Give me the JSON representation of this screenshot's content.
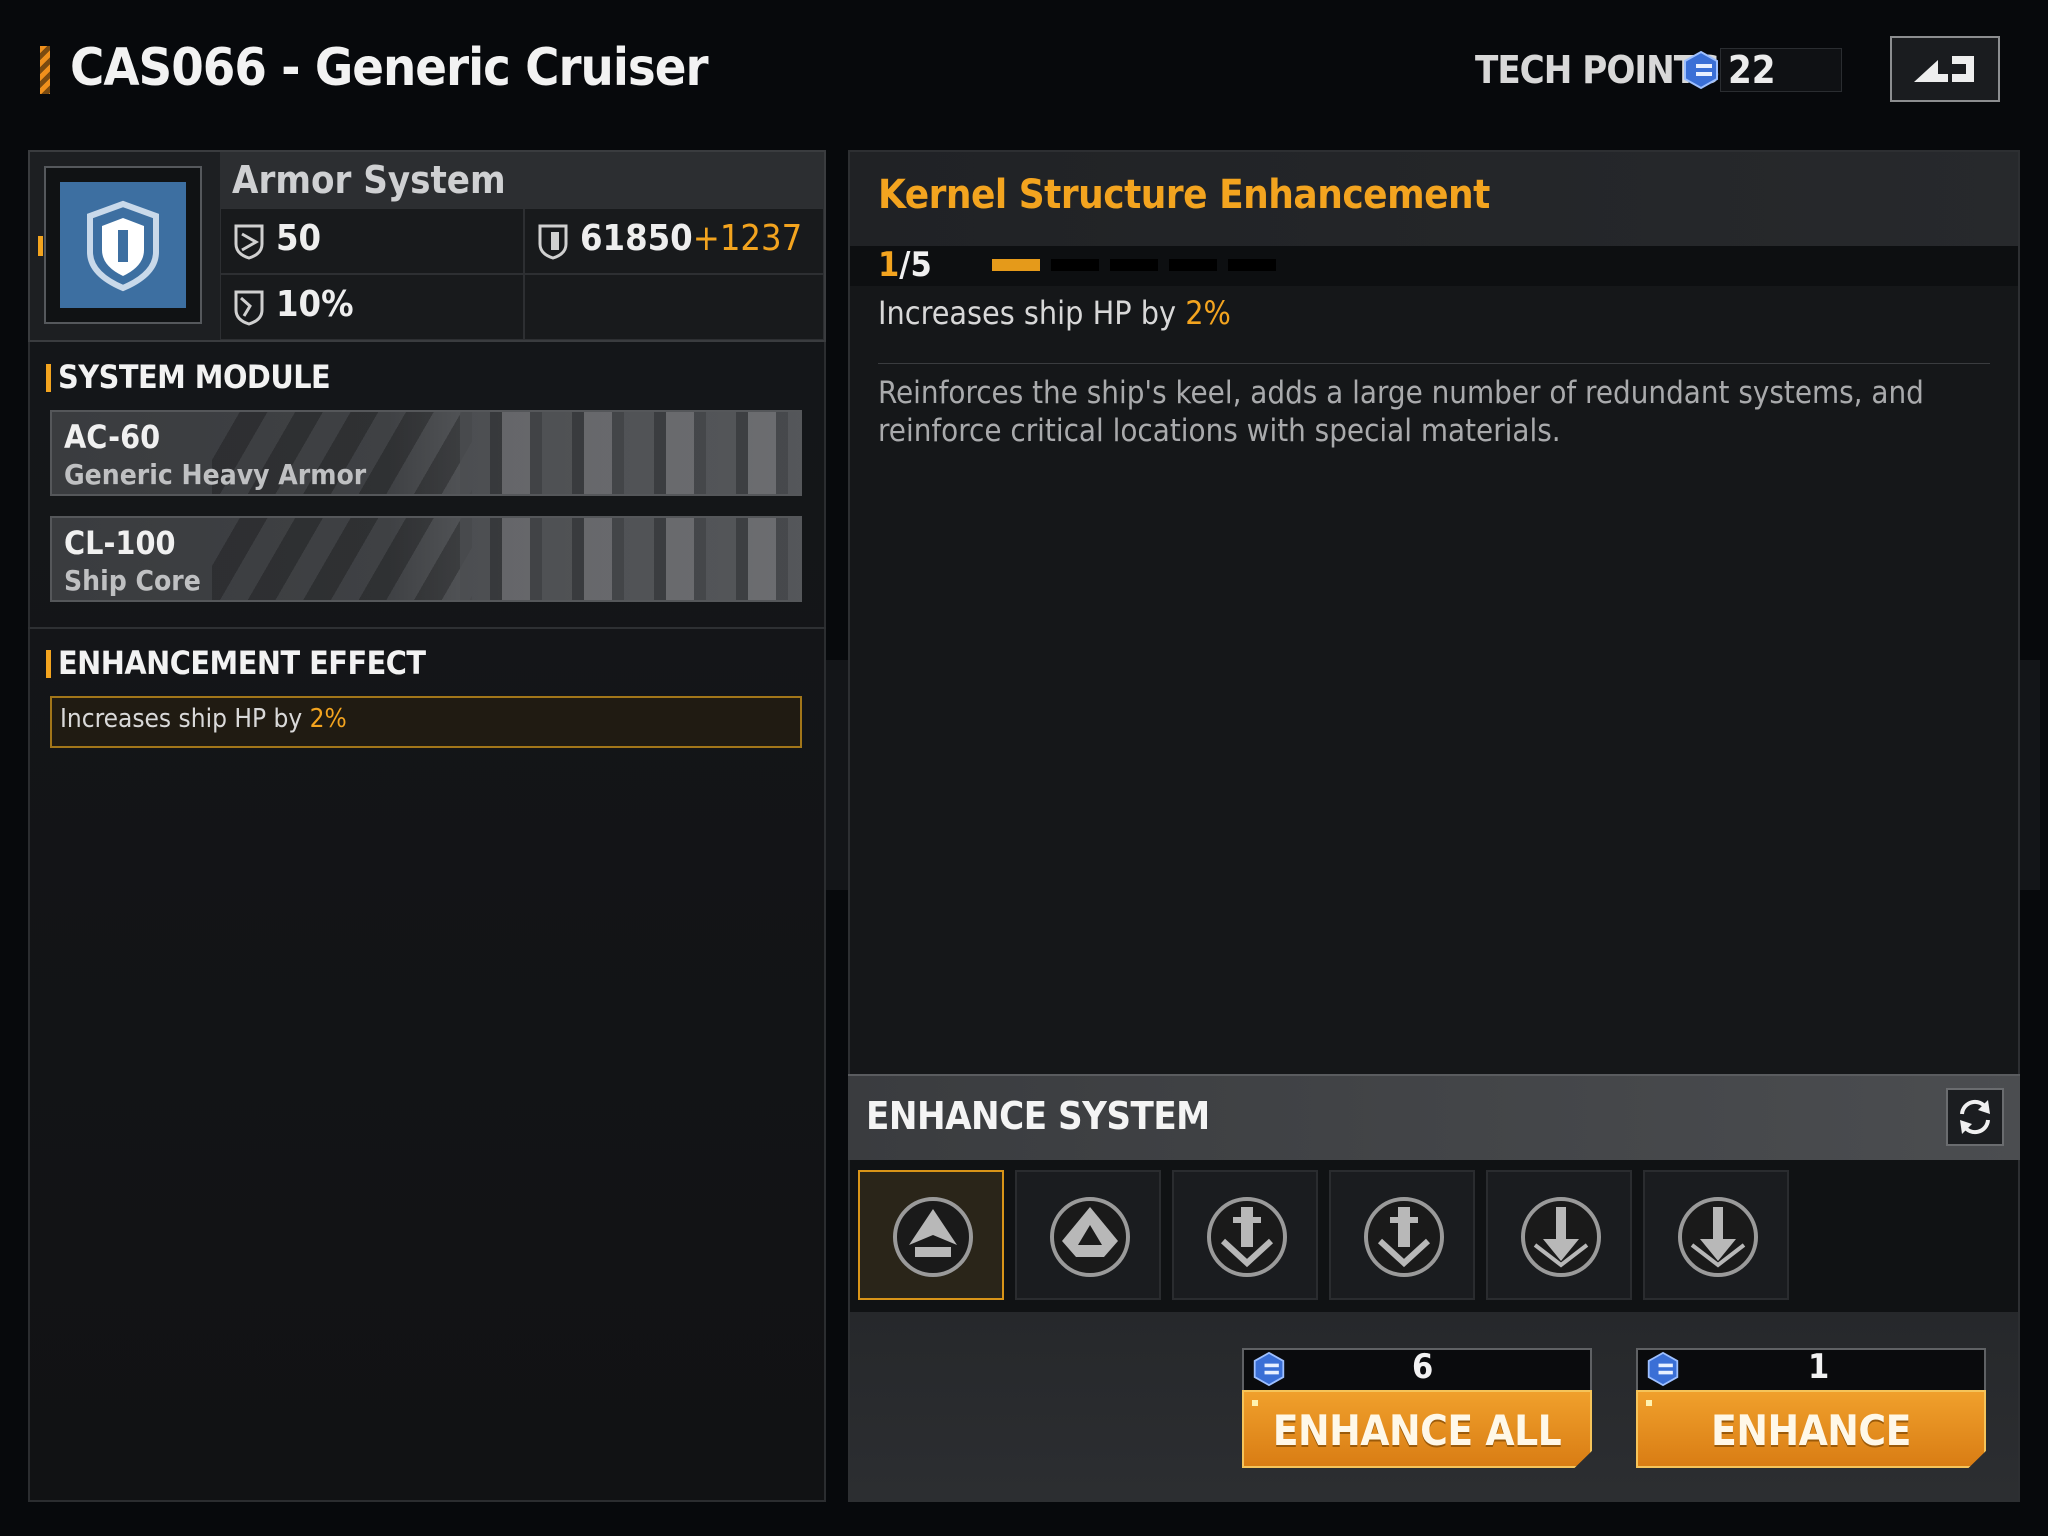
{
  "header": {
    "title": "CAS066 - Generic Cruiser",
    "tech_points_label": "TECH POINTS:",
    "tech_points_value": "22",
    "back_icon": "return-arrow-icon"
  },
  "system": {
    "name": "Armor System",
    "stat1": "50",
    "stat2": "10%",
    "hp_base": "61850",
    "hp_bonus": "+1237"
  },
  "system_module": {
    "title": "SYSTEM MODULE",
    "items": [
      {
        "code": "AC-60",
        "name": "Generic Heavy Armor"
      },
      {
        "code": "CL-100",
        "name": "Ship Core"
      }
    ]
  },
  "enhancement_effect": {
    "title": "ENHANCEMENT EFFECT",
    "text_prefix": "Increases ship HP by ",
    "text_value": "2%"
  },
  "detail": {
    "title": "Kernel Structure Enhancement",
    "level_current": "1",
    "level_max": "/5",
    "level_progress": 0.2,
    "effect_prefix": "Increases ship HP by ",
    "effect_value": "2%",
    "description": "Reinforces the ship's keel, adds a large number of redundant systems, and reinforce critical locations with special materials."
  },
  "enhance_system": {
    "title": "ENHANCE SYSTEM",
    "selected_index": 0,
    "tiles": [
      "kernel-icon",
      "hull-icon",
      "anchor-icon",
      "anchor-icon",
      "arrow-down-icon",
      "arrow-down-icon"
    ],
    "enhance_all": {
      "cost": "6",
      "label": "ENHANCE ALL"
    },
    "enhance": {
      "cost": "1",
      "label": "ENHANCE"
    }
  },
  "colors": {
    "accent": "#f3a41f",
    "icon_blue": "#3d6fa1",
    "button_orange": "#e48b1c"
  }
}
